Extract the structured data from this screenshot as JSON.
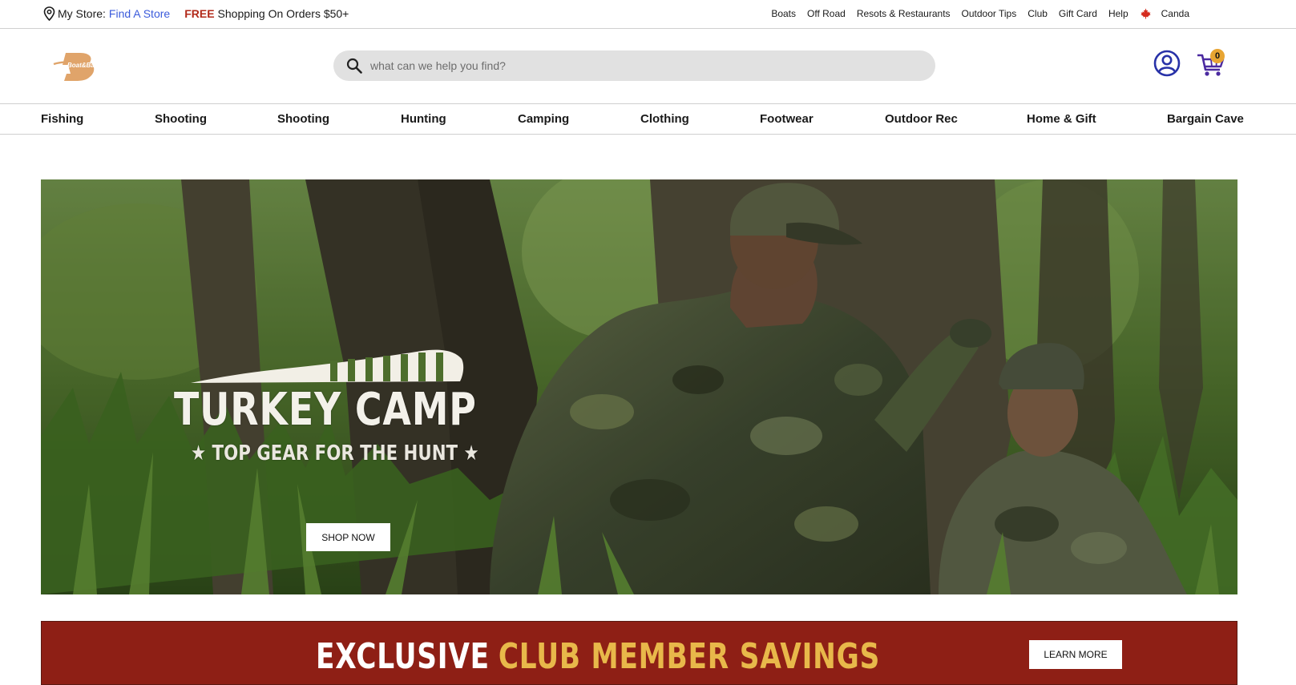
{
  "topbar": {
    "store_label": "My Store:",
    "store_link": "Find A Store",
    "free_label": "FREE",
    "shipping_text": "Shopping On Orders $50+",
    "links": [
      "Boats",
      "Off Road",
      "Resots & Restaurants",
      "Outdoor Tips",
      "Club",
      "Gift Card",
      "Help"
    ],
    "country": "Canda"
  },
  "header": {
    "logo_text": "Boat&Bait",
    "search_placeholder": "what can we help you find?",
    "cart_count": "0"
  },
  "nav": {
    "items": [
      "Fishing",
      "Shooting",
      "Shooting",
      "Hunting",
      "Camping",
      "Clothing",
      "Footwear",
      "Outdoor Rec",
      "Home & Gift",
      "Bargain Cave"
    ]
  },
  "hero": {
    "title": "TURKEY CAMP",
    "subtitle": "★ TOP GEAR FOR THE HUNT ★",
    "button": "SHOP NOW"
  },
  "promo": {
    "text_white": "EXCLUSIVE",
    "text_gold": "CLUB MEMBER SAVINGS",
    "button": "LEARN MORE"
  },
  "colors": {
    "link": "#3b5bdb",
    "free": "#b22a1a",
    "account": "#2832a8",
    "cart": "#4b2aa0",
    "badge": "#e8a532",
    "promo_bg": "#8e1f15",
    "promo_gold": "#e8b84a",
    "logo": "#e0a46a"
  },
  "icons": {
    "location": "map-pin-icon",
    "flag": "canada-flag-icon",
    "search": "search-icon",
    "account": "user-circle-icon",
    "cart": "shopping-cart-icon"
  }
}
